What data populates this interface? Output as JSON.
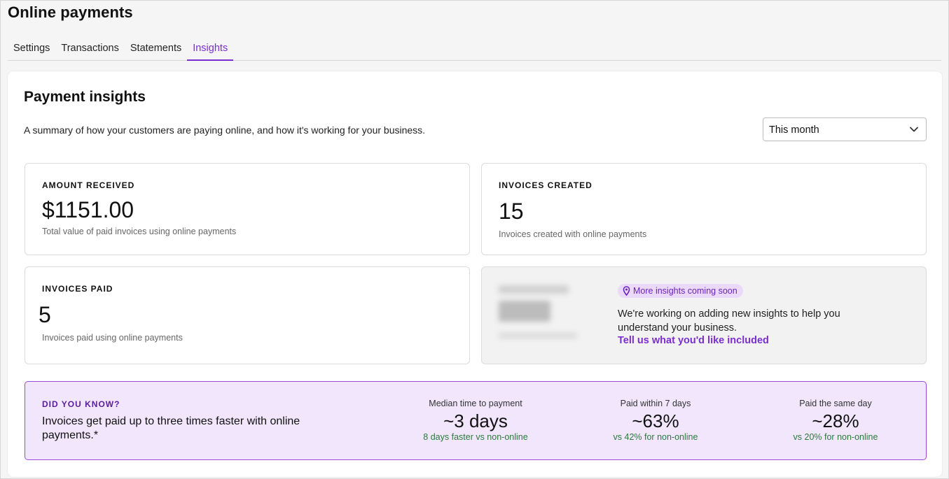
{
  "page": {
    "title": "Online payments"
  },
  "tabs": [
    {
      "label": "Settings",
      "active": false
    },
    {
      "label": "Transactions",
      "active": false
    },
    {
      "label": "Statements",
      "active": false
    },
    {
      "label": "Insights",
      "active": true
    }
  ],
  "insights": {
    "title": "Payment insights",
    "subtitle": "A summary of how your customers are paying online, and how it's working for your business.",
    "period": {
      "selected": "This month"
    }
  },
  "metrics": {
    "amount_received": {
      "label": "AMOUNT RECEIVED",
      "value": "$1151.00",
      "description": "Total value of paid invoices using online payments"
    },
    "invoices_created": {
      "label": "INVOICES CREATED",
      "value": "15",
      "description": "Invoices created with online payments"
    },
    "invoices_paid": {
      "label": "INVOICES PAID",
      "value": "5",
      "description": "Invoices paid using online payments"
    }
  },
  "coming_soon": {
    "badge": "More insights coming soon",
    "text": "We're working on adding new insights to help you understand your business.",
    "link": "Tell us what you'd like included"
  },
  "did_you_know": {
    "label": "DID YOU KNOW?",
    "text": "Invoices get paid up to three times faster with online payments.*",
    "stats": [
      {
        "label": "Median time to payment",
        "value": "~3 days",
        "note": "8 days faster vs non-online"
      },
      {
        "label": "Paid within 7 days",
        "value": "~63%",
        "note": "vs 42% for non-online"
      },
      {
        "label": "Paid the same day",
        "value": "~28%",
        "note": "vs 20% for non-online"
      }
    ]
  },
  "colors": {
    "accent": "#7a2ed1",
    "banner_bg": "#f1e6fc",
    "banner_border": "#9c4bd6",
    "positive_note": "#2b7a3a"
  },
  "icons": {
    "dropdown": "chevron-down-icon",
    "badge": "map-pin-icon"
  }
}
